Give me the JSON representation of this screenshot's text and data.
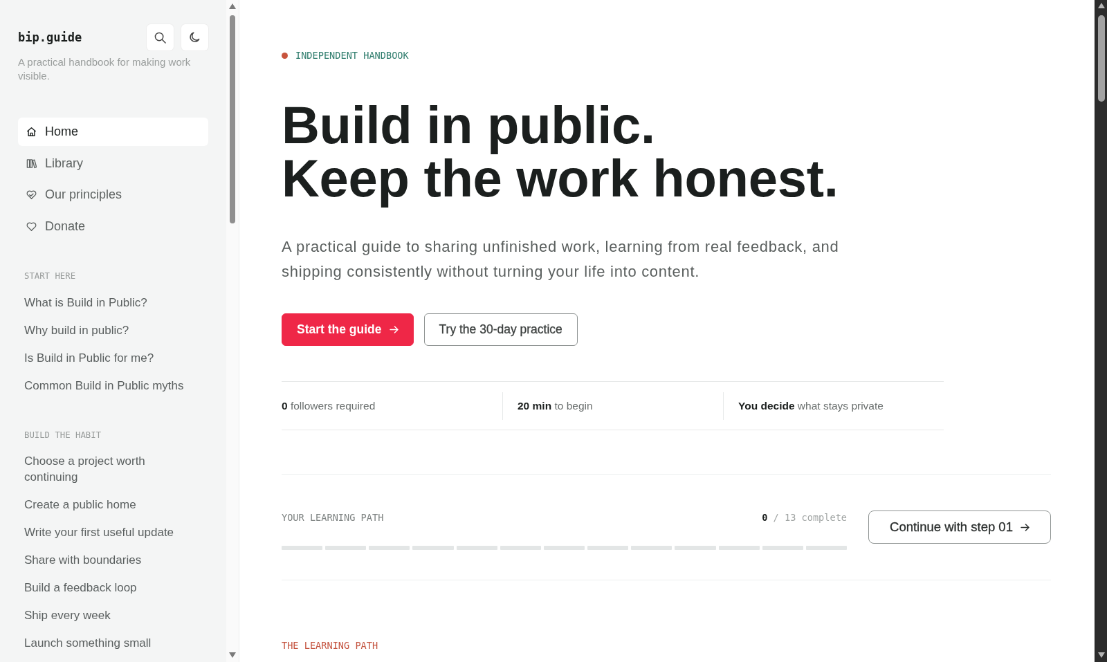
{
  "sidebar": {
    "logo": "bip.guide",
    "tagline": "A practical handbook for making work visible.",
    "nav": [
      {
        "label": "Home",
        "selected": true
      },
      {
        "label": "Library",
        "selected": false
      },
      {
        "label": "Our principles",
        "selected": false
      },
      {
        "label": "Donate",
        "selected": false
      }
    ],
    "sections": [
      {
        "heading": "START HERE",
        "items": [
          "What is Build in Public?",
          "Why build in public?",
          "Is Build in Public for me?",
          "Common Build in Public myths"
        ]
      },
      {
        "heading": "BUILD THE HABIT",
        "items": [
          "Choose a project worth continuing",
          "Create a public home",
          "Write your first useful update",
          "Share with boundaries",
          "Build a feedback loop",
          "Ship every week",
          "Launch something small"
        ]
      }
    ]
  },
  "hero": {
    "eyebrow": "INDEPENDENT HANDBOOK",
    "title_lines": [
      "Build in public.",
      "Keep the work honest."
    ],
    "intro": "A practical guide to sharing unfinished work, learning from real feedback, and shipping consistently without turning your life into content.",
    "buttons": [
      {
        "label": "Start the guide",
        "kind": "primary"
      },
      {
        "label": "Try the 30-day practice",
        "kind": "secondary"
      }
    ],
    "stats": [
      "**0** followers required",
      "**20 min** to begin",
      "**You decide** what stays private"
    ]
  },
  "learning_path": {
    "label": "YOUR LEARNING PATH",
    "progress": "**0** / 13 complete",
    "segments": [
      {
        "completed": false
      },
      {
        "completed": false
      },
      {
        "completed": false
      },
      {
        "completed": false
      },
      {
        "completed": false
      },
      {
        "completed": false
      },
      {
        "completed": false
      },
      {
        "completed": false
      },
      {
        "completed": false
      },
      {
        "completed": false
      },
      {
        "completed": false
      },
      {
        "completed": false
      },
      {
        "completed": false
      }
    ],
    "button": "Continue with step 01"
  },
  "next_section": {
    "label": "THE LEARNING PATH"
  }
}
